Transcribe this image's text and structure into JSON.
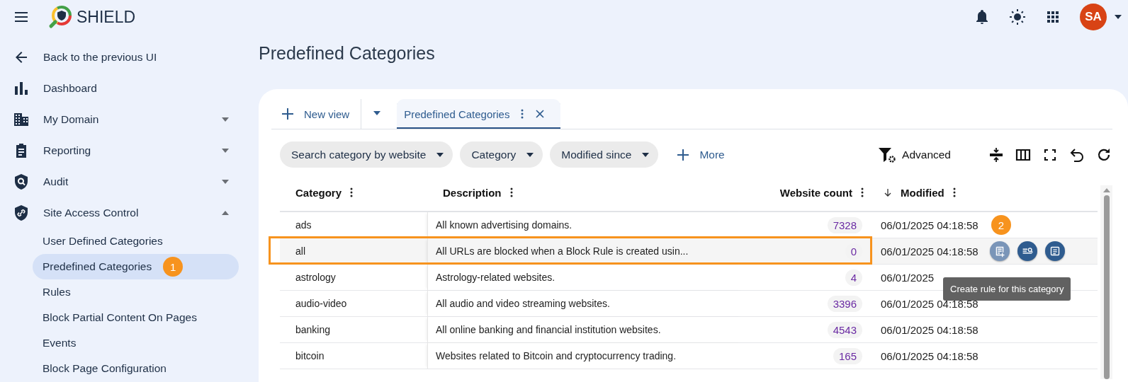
{
  "header": {
    "app_name": "SHIELD",
    "avatar_initials": "SA"
  },
  "sidebar": {
    "items": [
      {
        "label": "Back to the previous UI",
        "kind": "back"
      },
      {
        "label": "Dashboard",
        "kind": "chart"
      },
      {
        "label": "My Domain",
        "kind": "building",
        "expanded": false
      },
      {
        "label": "Reporting",
        "kind": "clipboard",
        "expanded": false
      },
      {
        "label": "Audit",
        "kind": "shield-search",
        "expanded": false
      },
      {
        "label": "Site Access Control",
        "kind": "shield-link",
        "expanded": true,
        "children": [
          {
            "label": "User Defined Categories",
            "selected": false
          },
          {
            "label": "Predefined Categories",
            "selected": true,
            "badge": "1"
          },
          {
            "label": "Rules",
            "selected": false
          },
          {
            "label": "Block Partial Content On Pages",
            "selected": false
          },
          {
            "label": "Events",
            "selected": false
          },
          {
            "label": "Block Page Configuration",
            "selected": false
          }
        ]
      }
    ]
  },
  "page_title": "Predefined Categories",
  "tabs": {
    "new_view": "New view",
    "items": [
      {
        "label": "Predefined Categories",
        "selected": true
      }
    ]
  },
  "filters": [
    "Search category by website",
    "Category",
    "Modified since"
  ],
  "more": "More",
  "advanced": "Advanced",
  "table": {
    "columns": [
      {
        "label": "Category"
      },
      {
        "label": "Description"
      },
      {
        "label": "Website count"
      },
      {
        "label": "Modified",
        "sorted": true
      }
    ],
    "rows": [
      {
        "category": "ads",
        "description": "All known advertising domains.",
        "count": "7328",
        "modified": "06/01/2025 04:18:58",
        "hovered": false,
        "annotated": false,
        "badge": "2"
      },
      {
        "category": "all",
        "description": "All URLs are blocked when a Block Rule is created usin...",
        "count": "0",
        "modified": "06/01/2025 04:18:58",
        "hovered": true,
        "annotated": true,
        "actions": [
          {
            "kind": "create-rule",
            "hovered": true
          },
          {
            "kind": "search-list",
            "hovered": false
          },
          {
            "kind": "details",
            "hovered": false
          }
        ]
      },
      {
        "category": "astrology",
        "description": "Astrology-related websites.",
        "count": "4",
        "modified": "06/01/2025",
        "hovered": false,
        "annotated": false
      },
      {
        "category": "audio-video",
        "description": "All audio and video streaming websites.",
        "count": "3396",
        "modified": "06/01/2025 04:18:58",
        "hovered": false,
        "annotated": false
      },
      {
        "category": "banking",
        "description": "All online banking and financial institution websites.",
        "count": "4543",
        "modified": "06/01/2025 04:18:58",
        "hovered": false,
        "annotated": false
      },
      {
        "category": "bitcoin",
        "description": "Websites related to Bitcoin and cryptocurrency trading.",
        "count": "165",
        "modified": "06/01/2025 04:18:58",
        "hovered": false,
        "annotated": false
      }
    ]
  },
  "tooltip": "Create rule for this category"
}
